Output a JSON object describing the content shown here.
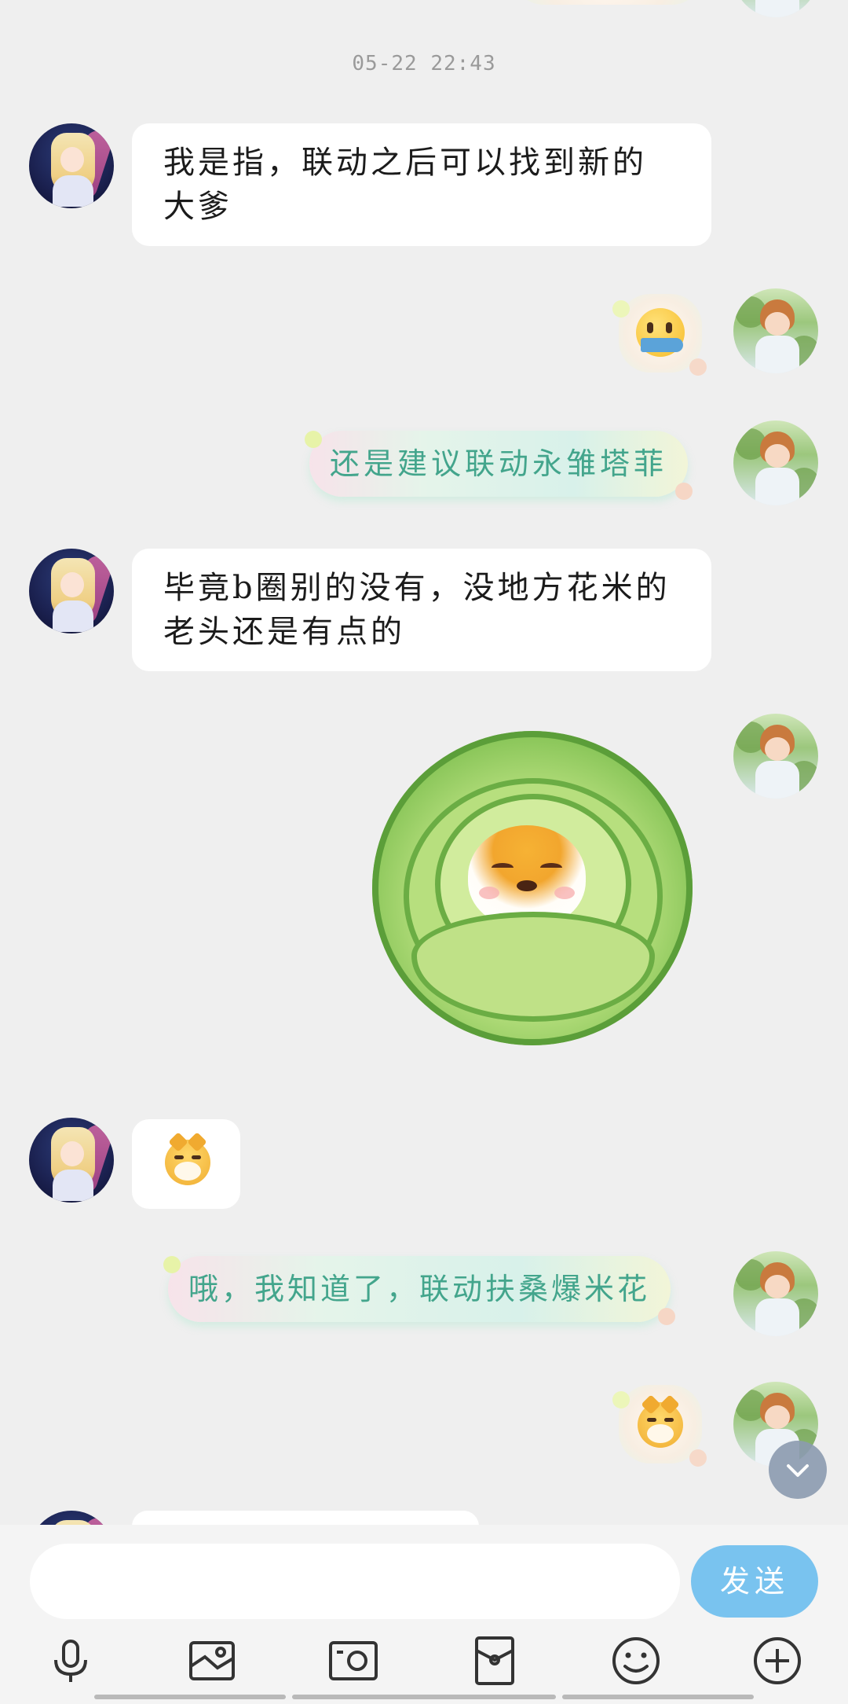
{
  "chat": {
    "timestamp": "05-22 22:43",
    "messages": [
      {
        "side": "left",
        "type": "text",
        "text": "我是指，联动之后可以找到新的大爹"
      },
      {
        "side": "right",
        "type": "emoji",
        "icon": "fish-face-emoji-icon"
      },
      {
        "side": "right",
        "type": "fancy-text",
        "text": "还是建议联动永雏塔菲"
      },
      {
        "side": "left",
        "type": "text",
        "text": "毕竟b圈别的没有，没地方花米的老头还是有点的"
      },
      {
        "side": "right",
        "type": "sticker",
        "icon": "cabbage-doge-sticker-icon"
      },
      {
        "side": "left",
        "type": "emoji",
        "icon": "doge-smirk-emoji-icon"
      },
      {
        "side": "right",
        "type": "fancy-text",
        "text": "哦，我知道了，联动扶桑爆米花"
      },
      {
        "side": "right",
        "type": "emoji",
        "icon": "doge-smirk-emoji-icon"
      }
    ]
  },
  "input": {
    "placeholder": "",
    "send_label": "发送"
  },
  "toolbar": {
    "icons": [
      "microphone-icon",
      "image-icon",
      "camera-icon",
      "red-packet-icon",
      "smiley-icon",
      "plus-icon"
    ]
  },
  "colors": {
    "background": "#efefef",
    "send_button": "#79c3ef",
    "fancy_text": "#43a58c"
  }
}
